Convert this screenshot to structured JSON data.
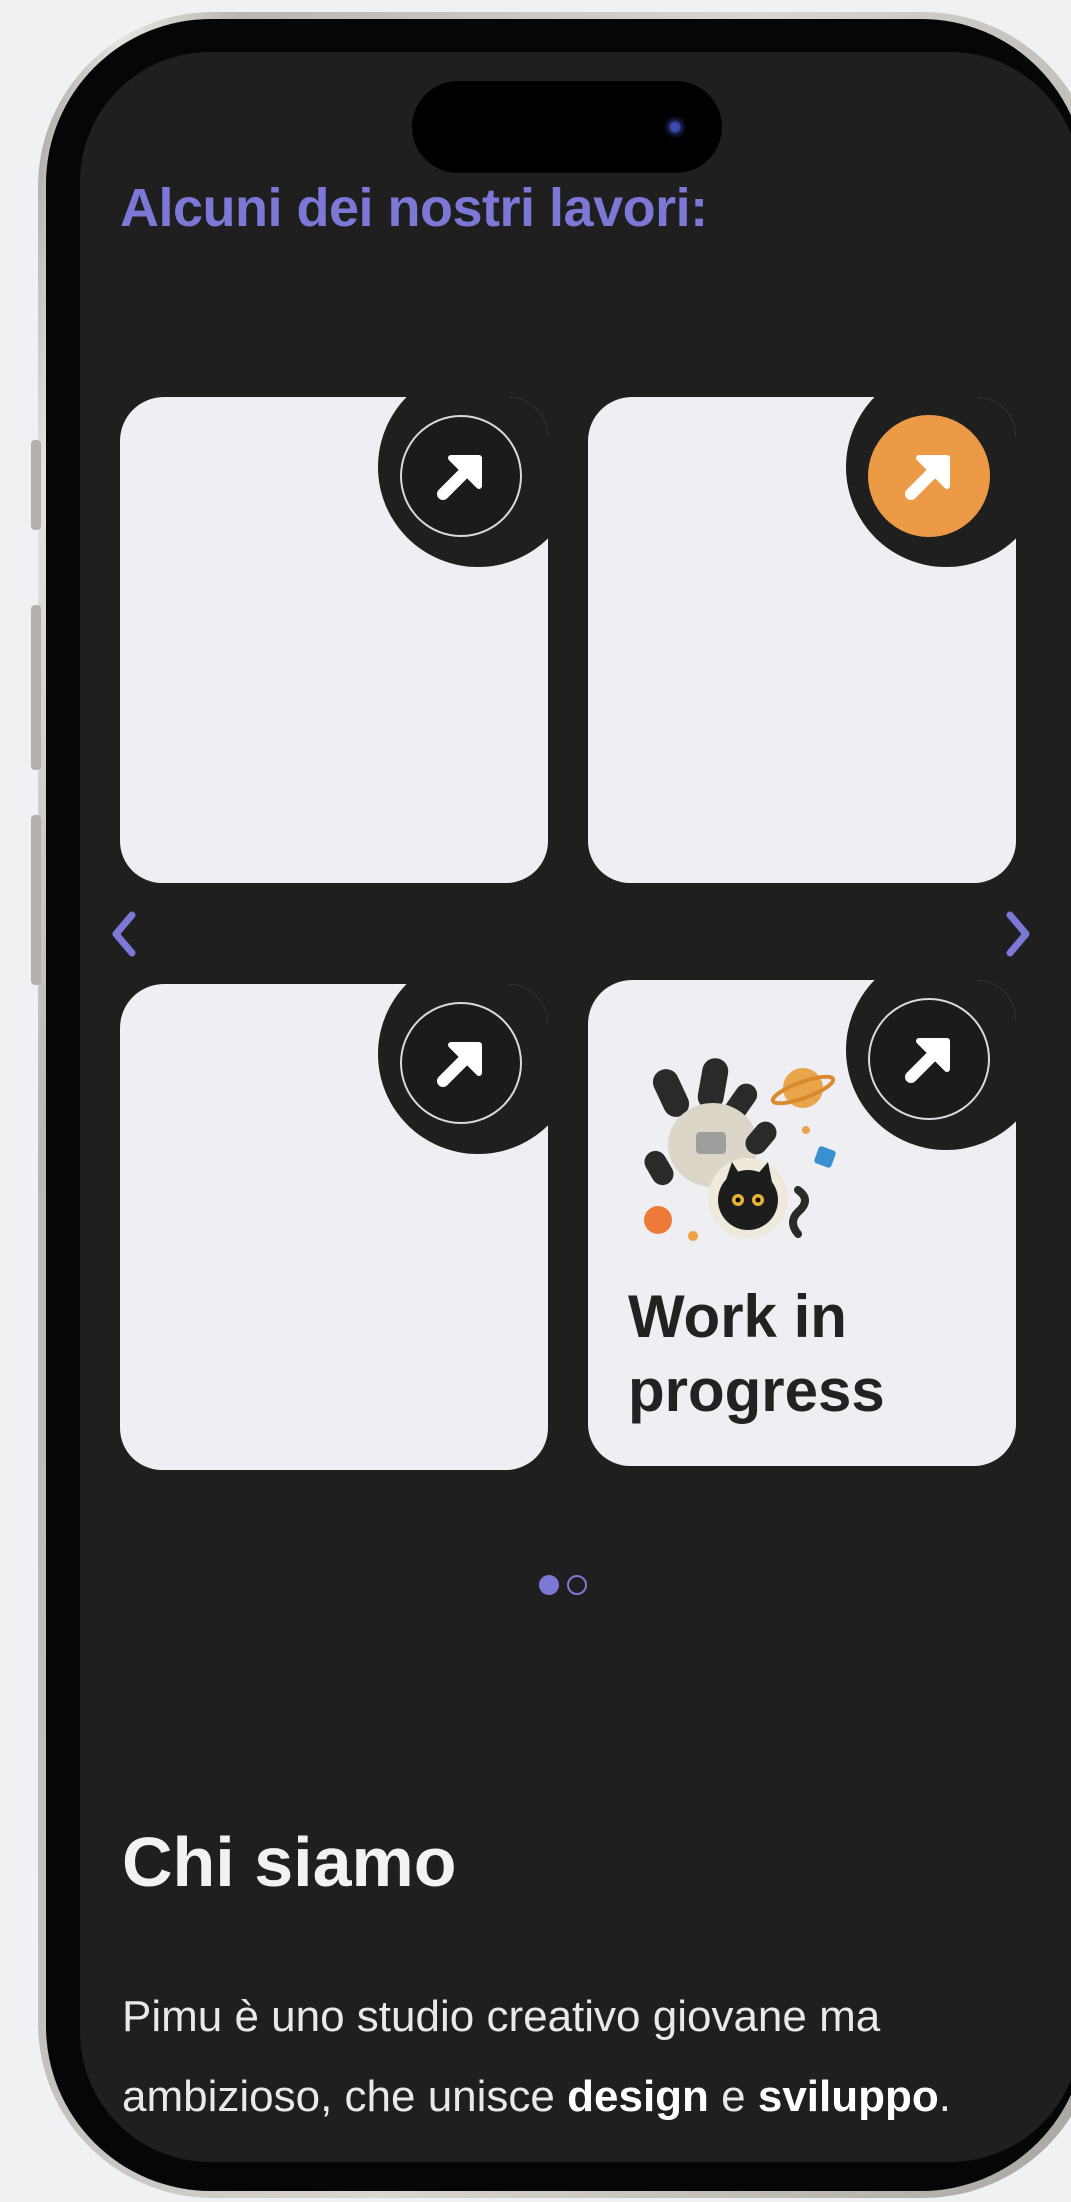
{
  "section": {
    "title": "Alcuni dei nostri lavori:"
  },
  "cards": [
    {
      "arrow_icon": "arrow-up-right-icon",
      "accent": false
    },
    {
      "arrow_icon": "arrow-up-right-icon",
      "accent": true,
      "accent_color": "#ec9a45"
    },
    {
      "arrow_icon": "arrow-up-right-icon",
      "accent": false
    },
    {
      "arrow_icon": "arrow-up-right-icon",
      "accent": false,
      "title": "Work in progress",
      "image_icon": "astronaut-cat-illustration"
    }
  ],
  "carousel": {
    "prev_icon": "chevron-left-icon",
    "next_icon": "chevron-right-icon",
    "pages": 2,
    "active_page": 1
  },
  "about": {
    "title": "Chi siamo",
    "text_part1": "Pimu è uno studio creativo giovane ma ambizioso, che unisce ",
    "text_bold1": "design",
    "text_part2": " e ",
    "text_bold2": "sviluppo",
    "text_part3": "."
  },
  "colors": {
    "accent": "#7b78d6",
    "orange": "#ec9a45",
    "background": "#1f1f20",
    "card": "#efeff3"
  }
}
